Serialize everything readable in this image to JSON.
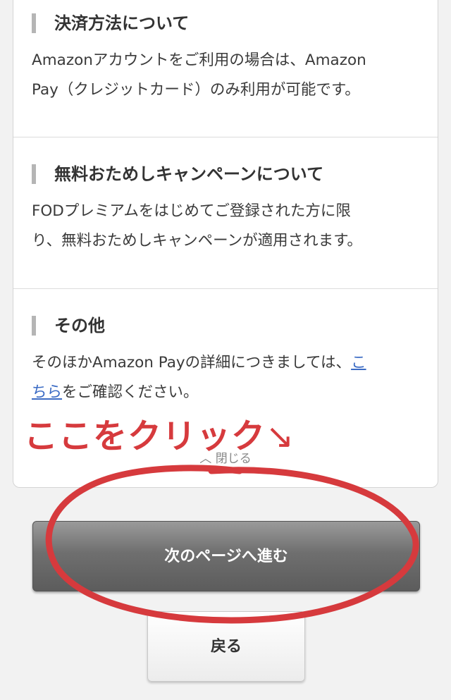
{
  "sections": [
    {
      "heading": "決済方法について",
      "body_lines": [
        "Amazonアカウントをご利用の場合は、Amazon",
        "Pay（クレジットカード）のみ利用が可能です。"
      ]
    },
    {
      "heading": "無料おためしキャンペーンについて",
      "body_lines": [
        "FODプレミアムをはじめてご登録された方に限",
        "り、無料おためしキャンペーンが適用されます。"
      ]
    },
    {
      "heading": "その他",
      "body_line1_prefix": "そのほかAmazon Payの詳細につきましては、",
      "body_line1_link": "こ",
      "body_line2_link": "ちら",
      "body_line2_suffix": "をご確認ください。"
    }
  ],
  "close_label": "閉じる",
  "close_icon": "chevron-up-icon",
  "annotation": {
    "text": "ここをクリック",
    "arrow_glyph": "↘",
    "color": "#d63a3d"
  },
  "next_button_label": "次のページへ進む",
  "back_button_label": "戻る"
}
